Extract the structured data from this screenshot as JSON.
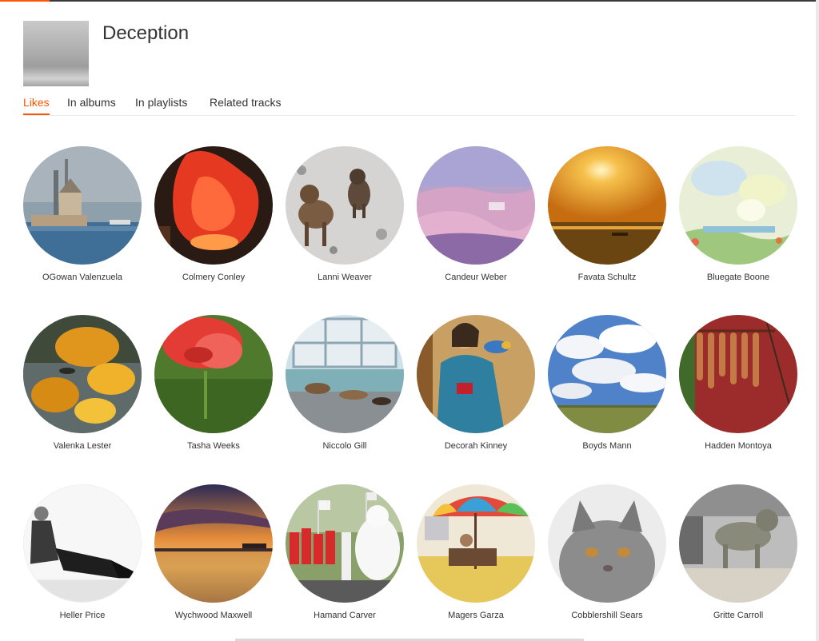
{
  "track": {
    "title": "Deception"
  },
  "tabs": [
    {
      "label": "Likes",
      "active": true
    },
    {
      "label": "In albums",
      "active": false
    },
    {
      "label": "In playlists",
      "active": false
    },
    {
      "label": "Related tracks",
      "active": false
    }
  ],
  "accent_color": "#ff5500",
  "users": [
    {
      "name": "OGowan Valenzuela",
      "avatar": "avatar-lighthouse-harbor"
    },
    {
      "name": "Colmery Conley",
      "avatar": "avatar-red-ice-sculpture"
    },
    {
      "name": "Lanni Weaver",
      "avatar": "avatar-puppies-in-snow"
    },
    {
      "name": "Candeur Weber",
      "avatar": "avatar-pink-frosted-forest"
    },
    {
      "name": "Favata Schultz",
      "avatar": "avatar-sunset-over-sea"
    },
    {
      "name": "Bluegate Boone",
      "avatar": "avatar-watercolor-flowers"
    },
    {
      "name": "Valenka Lester",
      "avatar": "avatar-autumn-leaves-pond"
    },
    {
      "name": "Tasha Weeks",
      "avatar": "avatar-red-flower"
    },
    {
      "name": "Niccolo Gill",
      "avatar": "avatar-cats-on-roof"
    },
    {
      "name": "Decorah Kinney",
      "avatar": "avatar-woman-with-bird-painting"
    },
    {
      "name": "Boyds Mann",
      "avatar": "avatar-clouds-over-field"
    },
    {
      "name": "Hadden Montoya",
      "avatar": "avatar-hanging-dried-fish"
    },
    {
      "name": "Heller Price",
      "avatar": "avatar-woman-sitting-bw"
    },
    {
      "name": "Wychwood Maxwell",
      "avatar": "avatar-sunset-lake"
    },
    {
      "name": "Hamand Carver",
      "avatar": "avatar-parade-polar-bear"
    },
    {
      "name": "Magers Garza",
      "avatar": "avatar-umbrella-beach-chair"
    },
    {
      "name": "Cobblershill Sears",
      "avatar": "avatar-grey-kitten"
    },
    {
      "name": "Gritte Carroll",
      "avatar": "avatar-tabby-cat"
    }
  ]
}
